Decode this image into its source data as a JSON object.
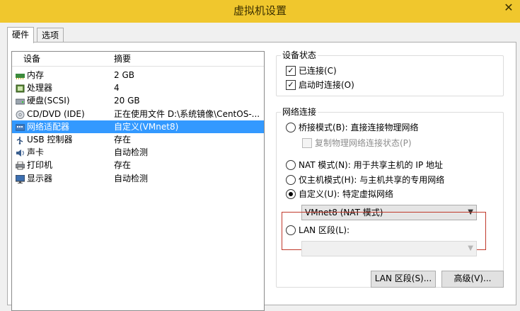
{
  "window": {
    "title": "虚拟机设置",
    "close_label": "✕"
  },
  "tabs": [
    {
      "label": "硬件"
    },
    {
      "label": "选项"
    }
  ],
  "device_table": {
    "headers": {
      "device": "设备",
      "summary": "摘要"
    },
    "rows": [
      {
        "device": "内存",
        "summary": "2 GB",
        "icon": "memory-icon",
        "selected": false
      },
      {
        "device": "处理器",
        "summary": "4",
        "icon": "processor-icon",
        "selected": false
      },
      {
        "device": "硬盘(SCSI)",
        "summary": "20 GB",
        "icon": "hard-disk-icon",
        "selected": false
      },
      {
        "device": "CD/DVD (IDE)",
        "summary": "正在使用文件 D:\\系统镜像\\CentOS-...",
        "icon": "cd-dvd-icon",
        "selected": false
      },
      {
        "device": "网络适配器",
        "summary": "自定义(VMnet8)",
        "icon": "network-adapter-icon",
        "selected": true
      },
      {
        "device": "USB 控制器",
        "summary": "存在",
        "icon": "usb-icon",
        "selected": false
      },
      {
        "device": "声卡",
        "summary": "自动检测",
        "icon": "sound-card-icon",
        "selected": false
      },
      {
        "device": "打印机",
        "summary": "存在",
        "icon": "printer-icon",
        "selected": false
      },
      {
        "device": "显示器",
        "summary": "自动检测",
        "icon": "display-icon",
        "selected": false
      }
    ]
  },
  "device_status": {
    "legend": "设备状态",
    "connected": {
      "label": "已连接(C)",
      "checked": true
    },
    "connect_at_power_on": {
      "label": "启动时连接(O)",
      "checked": true
    }
  },
  "network": {
    "legend": "网络连接",
    "bridged": {
      "label": "桥接模式(B): 直接连接物理网络",
      "selected": false
    },
    "replicate": {
      "label": "复制物理网络连接状态(P)",
      "checked": false,
      "disabled": true
    },
    "nat": {
      "label": "NAT 模式(N): 用于共享主机的 IP 地址",
      "selected": false
    },
    "host_only": {
      "label": "仅主机模式(H): 与主机共享的专用网络",
      "selected": false
    },
    "custom": {
      "label": "自定义(U): 特定虚拟网络",
      "selected": true,
      "value": "VMnet8 (NAT 模式)"
    },
    "lan_segment": {
      "label": "LAN 区段(L):",
      "selected": false,
      "value": ""
    }
  },
  "buttons": {
    "lan_segments": "LAN 区段(S)...",
    "advanced": "高级(V)..."
  },
  "colors": {
    "titlebar": "#f0c72d",
    "selection": "#3399ff",
    "highlight_box": "#c0392b"
  }
}
